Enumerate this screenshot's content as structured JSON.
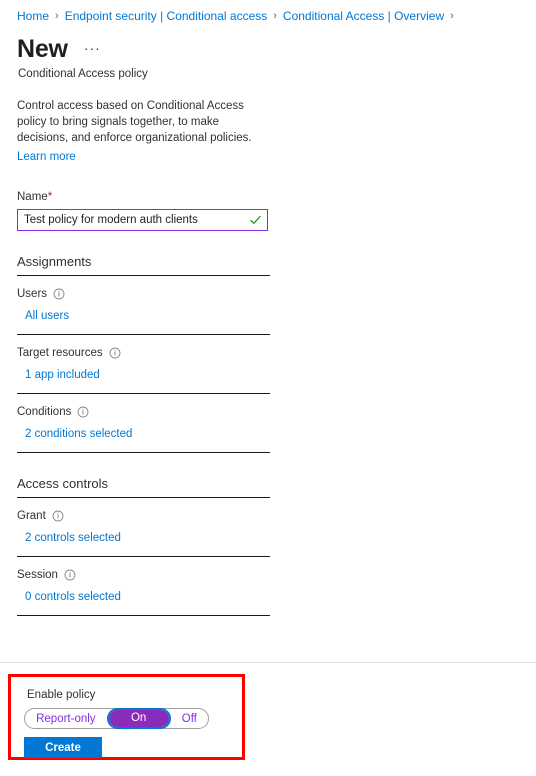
{
  "breadcrumb": {
    "separator": "›",
    "items": [
      {
        "label": "Home"
      },
      {
        "label": "Endpoint security | Conditional access"
      },
      {
        "label": "Conditional Access | Overview"
      }
    ]
  },
  "header": {
    "title": "New",
    "ellipsis": "···",
    "subtitle": "Conditional Access policy"
  },
  "intro": {
    "text": "Control access based on Conditional Access policy to bring signals together, to make decisions, and enforce organizational policies.",
    "learn_more": "Learn more"
  },
  "name_field": {
    "label": "Name",
    "required_marker": "*",
    "value": "Test policy for modern auth clients",
    "placeholder": "",
    "valid_icon": "checkmark-icon",
    "border_color": "#8a2be2",
    "check_color": "#107c10"
  },
  "sections": [
    {
      "heading": "Assignments",
      "rows": [
        {
          "label": "Users",
          "info_icon": "info-icon",
          "value": "All users"
        },
        {
          "label": "Target resources",
          "info_icon": "info-icon",
          "value": "1 app included"
        },
        {
          "label": "Conditions",
          "info_icon": "info-icon",
          "value": "2 conditions selected"
        }
      ]
    },
    {
      "heading": "Access controls",
      "rows": [
        {
          "label": "Grant",
          "info_icon": "info-icon",
          "value": "2 controls selected"
        },
        {
          "label": "Session",
          "info_icon": "info-icon",
          "value": "0 controls selected"
        }
      ]
    }
  ],
  "footer": {
    "enable_label": "Enable policy",
    "toggle": {
      "options": [
        "Report-only",
        "On",
        "Off"
      ],
      "selected": "On",
      "selected_color": "#8b2bb9",
      "option_color": "#8a2be2",
      "focus_ring_color": "#0078d4"
    },
    "create_label": "Create",
    "create_color": "#0078d4",
    "highlight_color": "#ff0000"
  },
  "link_color": "#0078d4"
}
